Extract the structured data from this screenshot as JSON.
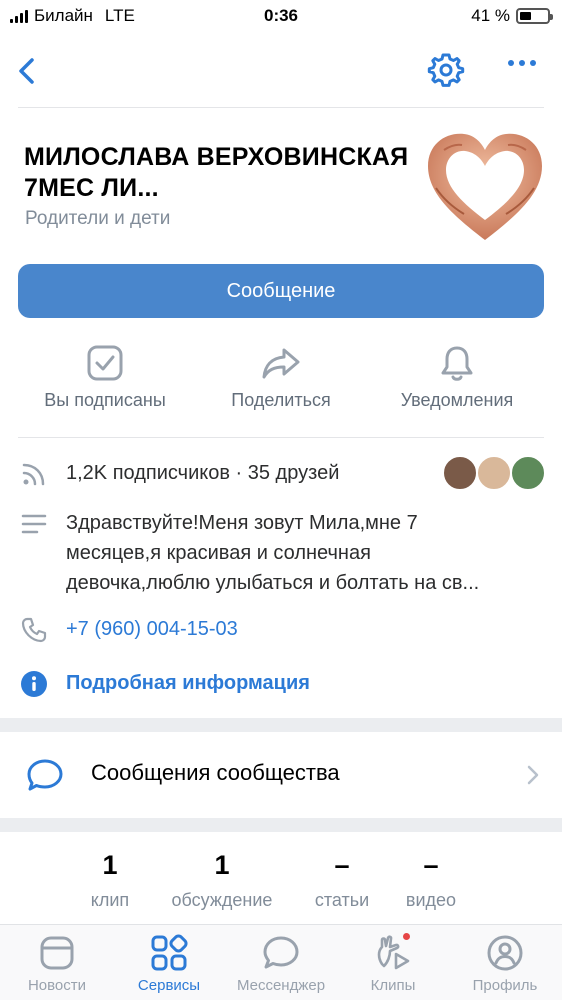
{
  "status_bar": {
    "carrier": "Билайн",
    "network": "LTE",
    "time": "0:36",
    "battery_percent": "41 %",
    "battery_level": 0.41
  },
  "nav": {
    "back_icon": "chevron-left-icon",
    "settings_icon": "gear-icon",
    "more_icon": "more-dots-icon"
  },
  "profile": {
    "title": "МИЛОСЛАВА ВЕРХОВИНСКАЯ 7МЕС ЛИ...",
    "category": "Родители и дети",
    "avatar_icon": "heart-hands-avatar"
  },
  "message_button": {
    "label": "Сообщение"
  },
  "actions": [
    {
      "label": "Вы подписаны",
      "icon": "check-square-icon"
    },
    {
      "label": "Поделиться",
      "icon": "share-arrow-icon"
    },
    {
      "label": "Уведомления",
      "icon": "bell-icon"
    }
  ],
  "info": {
    "followers": "1,2K подписчиков · 35 друзей",
    "description_line1": "Здравствуйте!Меня зовут Мила,мне 7",
    "description_line2": "месяцев,я красивая и солнечная",
    "description_line3": "девочка,люблю улыбаться и болтать на св...",
    "phone": "+7 (960) 004-15-03",
    "details_link": "Подробная информация"
  },
  "community_messages": {
    "label": "Сообщения сообщества",
    "icon": "chat-bubble-icon"
  },
  "counters": [
    {
      "value": "1",
      "label": "клип"
    },
    {
      "value": "1",
      "label": "обсуждение"
    },
    {
      "value": "–",
      "label": "статьи"
    },
    {
      "value": "–",
      "label": "видео"
    }
  ],
  "tabs": [
    {
      "label": "Новости",
      "icon": "news-icon",
      "active": false
    },
    {
      "label": "Сервисы",
      "icon": "services-icon",
      "active": true
    },
    {
      "label": "Мессенджер",
      "icon": "messenger-icon",
      "active": false
    },
    {
      "label": "Клипы",
      "icon": "clips-icon",
      "active": false
    },
    {
      "label": "Профиль",
      "icon": "profile-icon",
      "active": false
    }
  ],
  "colors": {
    "accent": "#2c7ad6",
    "button": "#4986cc",
    "secondary_text": "#818c99",
    "separator": "#ebedf0",
    "notification_dot": "#e64646"
  }
}
